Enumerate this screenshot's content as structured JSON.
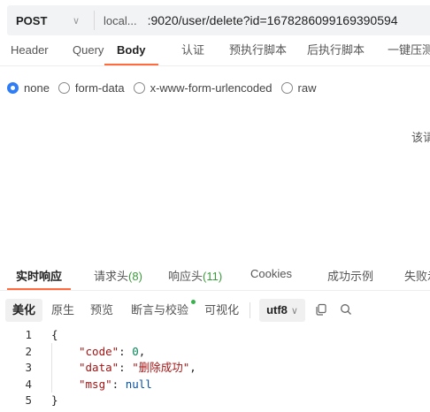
{
  "url_bar": {
    "method": "POST",
    "method_caret": "∨",
    "env": "local...",
    "url": ":9020/user/delete?id=1678286099169390594"
  },
  "request_tabs": [
    "Header",
    "Query",
    "Body",
    "认证",
    "预执行脚本",
    "后执行脚本",
    "一键压测"
  ],
  "active_request_tab": "Body",
  "body_types": [
    "none",
    "form-data",
    "x-www-form-urlencoded",
    "raw"
  ],
  "selected_body_type": "none",
  "hint_text": "该请",
  "response_tabs": [
    {
      "label": "实时响应"
    },
    {
      "label": "请求头",
      "count": "(8)"
    },
    {
      "label": "响应头",
      "count": "(11)"
    },
    {
      "label": "Cookies"
    },
    {
      "label": "成功示例"
    },
    {
      "label": "失败示"
    }
  ],
  "active_response_tab": "实时响应",
  "toolbar": {
    "buttons": [
      "美化",
      "原生",
      "预览",
      "断言与校验",
      "可视化"
    ],
    "active": "美化",
    "encoding": "utf8",
    "encoding_caret": "∨",
    "copy_icon": "copy-icon",
    "search_icon": "search-icon"
  },
  "code": {
    "line_numbers": [
      "1",
      "2",
      "3",
      "4",
      "5"
    ],
    "open_brace": "{",
    "close_brace": "}",
    "fields": [
      {
        "key": "\"code\"",
        "value": "0",
        "type": "number",
        "trail": ","
      },
      {
        "key": "\"data\"",
        "value": "\"删除成功\"",
        "type": "string",
        "trail": ","
      },
      {
        "key": "\"msg\"",
        "value": "null",
        "type": "keyword",
        "trail": ""
      }
    ]
  },
  "colors": {
    "accent": "#ff6b3d",
    "radio_selected": "#2f7df6",
    "count": "#3c9a3c"
  }
}
